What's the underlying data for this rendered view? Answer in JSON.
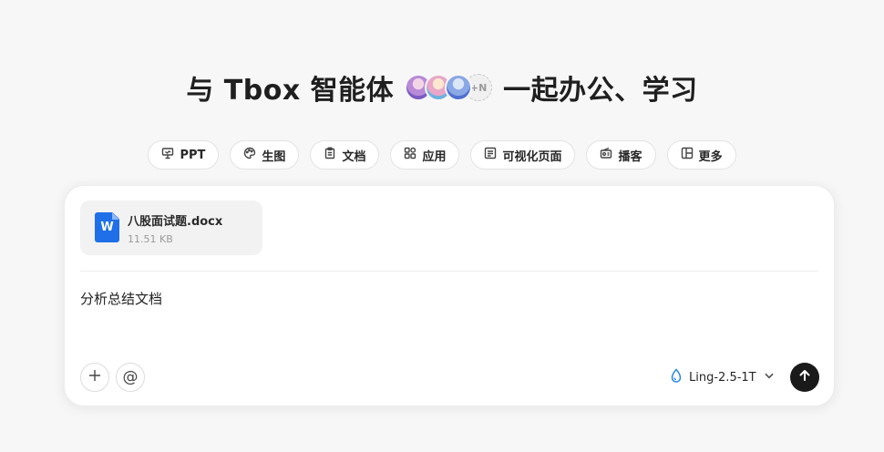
{
  "headline": {
    "before": "与 Tbox 智能体",
    "after": "一起办公、学习",
    "avatars_more": "+N"
  },
  "chips": [
    {
      "label": "PPT",
      "icon": "presentation-icon"
    },
    {
      "label": "生图",
      "icon": "palette-icon"
    },
    {
      "label": "文档",
      "icon": "clipboard-icon"
    },
    {
      "label": "应用",
      "icon": "apps-grid-icon"
    },
    {
      "label": "可视化页面",
      "icon": "page-icon"
    },
    {
      "label": "播客",
      "icon": "radio-icon"
    },
    {
      "label": "更多",
      "icon": "layout-icon"
    }
  ],
  "composer": {
    "file": {
      "name": "八股面试题.docx",
      "size": "11.51 KB",
      "icon_letter": "W",
      "icon_color": "#1f6fe8"
    },
    "prompt": "分析总结文档",
    "plus_icon": "plus-icon",
    "at_label": "@",
    "model": "Ling-2.5-1T",
    "send_icon": "arrow-up-icon"
  }
}
